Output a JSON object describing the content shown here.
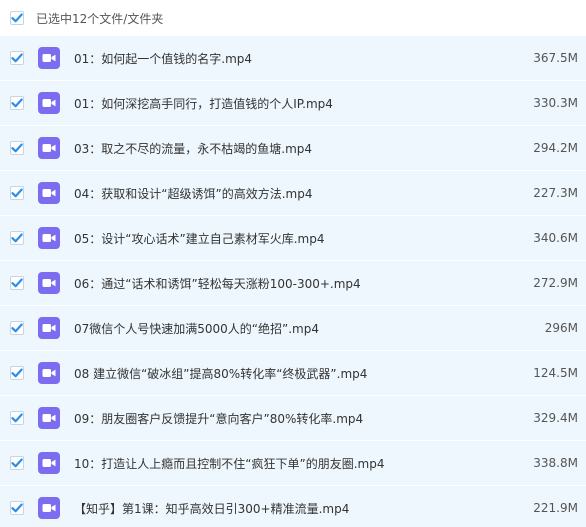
{
  "header": {
    "select_all_label": "已选中12个文件/文件夹"
  },
  "colors": {
    "row_background": "#eef7fd",
    "checkmark": "#2b8fe8",
    "video_icon": "#7b6cf0"
  },
  "icons": {
    "checkbox": "check-icon",
    "file": "video-file-icon"
  },
  "files": [
    {
      "name": "01：如何起一个值钱的名字.mp4",
      "size": "367.5M"
    },
    {
      "name": "01：如何深挖高手同行，打造值钱的个人IP.mp4",
      "size": "330.3M"
    },
    {
      "name": "03：取之不尽的流量，永不枯竭的鱼塘.mp4",
      "size": "294.2M"
    },
    {
      "name": "04：获取和设计“超级诱饵”的高效方法.mp4",
      "size": "227.3M"
    },
    {
      "name": "05：设计“攻心话术”建立自己素材军火库.mp4",
      "size": "340.6M"
    },
    {
      "name": "06：通过“话术和诱饵”轻松每天涨粉100-300+.mp4",
      "size": "272.9M"
    },
    {
      "name": "07微信个人号快速加满5000人的“绝招”.mp4",
      "size": "296M"
    },
    {
      "name": "08 建立微信“破冰组”提高80%转化率“终极武器”.mp4",
      "size": "124.5M"
    },
    {
      "name": "09：朋友圈客户反馈提升“意向客户”80%转化率.mp4",
      "size": "329.4M"
    },
    {
      "name": "10：打造让人上瘾而且控制不住“疯狂下单”的朋友圈.mp4",
      "size": "338.8M"
    },
    {
      "name": "【知乎】第1课：知乎高效日引300+精准流量.mp4",
      "size": "221.9M"
    }
  ]
}
